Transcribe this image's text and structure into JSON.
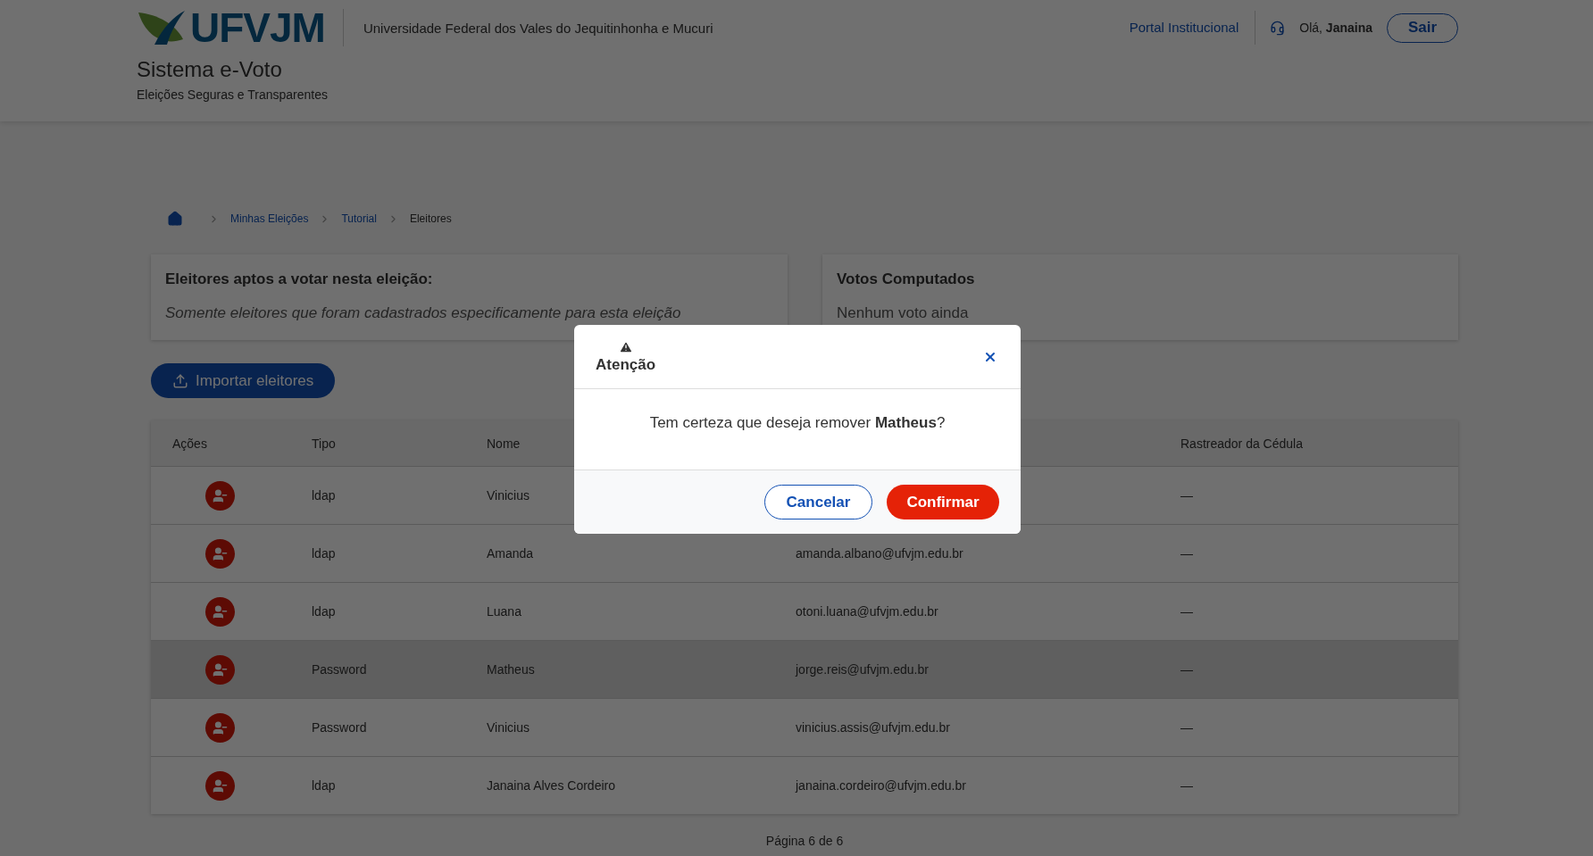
{
  "header": {
    "logo": "UFVJM",
    "university": "Universidade Federal dos Vales do Jequitinhonha e Mucuri",
    "system_title": "Sistema e-Voto",
    "tagline": "Eleições Seguras e Transparentes",
    "portal_link": "Portal Institucional",
    "greeting": "Olá,",
    "user": "Janaina",
    "logout": "Sair"
  },
  "breadcrumb": [
    {
      "label": "Minhas Eleições",
      "current": false
    },
    {
      "label": "Tutorial",
      "current": false
    },
    {
      "label": "Eleitores",
      "current": true
    }
  ],
  "cards": [
    {
      "title": "Eleitores aptos a votar nesta eleição:",
      "text": "Somente eleitores que foram cadastrados especificamente para esta eleição",
      "italic": true
    },
    {
      "title": "Votos Computados",
      "text": "Nenhum voto ainda",
      "italic": false
    }
  ],
  "import_button": "Importar eleitores",
  "table": {
    "columns": [
      {
        "kind": "text",
        "label": "Ações"
      },
      {
        "kind": "text",
        "label": "Tipo"
      },
      {
        "kind": "text",
        "label": "Nome"
      },
      {
        "kind": "covered"
      },
      {
        "kind": "text",
        "label": "Rastreador da Cédula"
      }
    ],
    "rows": [
      {
        "type": "ldap",
        "name": "Vinicius",
        "tracker": "—",
        "selected": false
      },
      {
        "type": "ldap",
        "name": "Amanda",
        "email": "amanda.albano@ufvjm.edu.br",
        "tracker": "—",
        "selected": false
      },
      {
        "type": "ldap",
        "name": "Luana",
        "email": "otoni.luana@ufvjm.edu.br",
        "tracker": "—",
        "selected": false
      },
      {
        "type": "Password",
        "name": "Matheus",
        "email": "jorge.reis@ufvjm.edu.br",
        "tracker": "—",
        "selected": true
      },
      {
        "type": "Password",
        "name": "Vinicius",
        "email": "vinicius.assis@ufvjm.edu.br",
        "tracker": "—",
        "selected": false
      },
      {
        "type": "ldap",
        "name": "Janaina Alves Cordeiro",
        "email": "janaina.cordeiro@ufvjm.edu.br",
        "tracker": "—",
        "selected": false
      }
    ]
  },
  "pagination": "Página 6 de 6",
  "modal": {
    "title": "Atenção",
    "message": "Tem certeza que deseja remover **Matheus**?",
    "cancel": "Cancelar",
    "confirm": "Confirmar"
  }
}
